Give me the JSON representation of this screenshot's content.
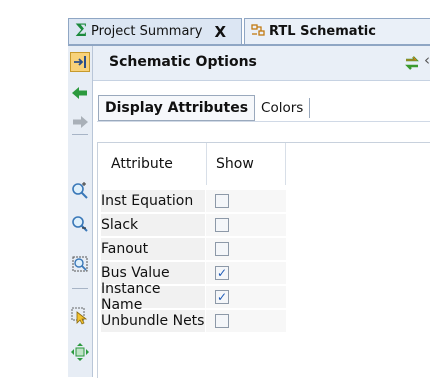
{
  "tabs": [
    {
      "label": "Project Summary",
      "icon": "sigma-icon",
      "close": "X"
    },
    {
      "label": "RTL Schematic",
      "icon": "schematic-icon"
    }
  ],
  "panel": {
    "title": "Schematic Options"
  },
  "subtabs": [
    {
      "label": "Display Attributes",
      "active": true
    },
    {
      "label": "Colors",
      "active": false
    }
  ],
  "table": {
    "headers": [
      "Attribute",
      "Show"
    ],
    "rows": [
      {
        "attribute": "Inst Equation",
        "show": false
      },
      {
        "attribute": "Slack",
        "show": false
      },
      {
        "attribute": "Fanout",
        "show": false
      },
      {
        "attribute": "Bus Value",
        "show": true
      },
      {
        "attribute": "Instance Name",
        "show": true
      },
      {
        "attribute": "Unbundle Nets",
        "show": false
      }
    ]
  },
  "toolbar": {
    "icons": [
      "collapse-panel-icon",
      "back-arrow-icon",
      "forward-arrow-icon",
      "zoom-in-icon",
      "zoom-out-icon",
      "zoom-fit-icon",
      "select-icon",
      "expand-icon"
    ]
  },
  "colors": {
    "accent": "#1c8a3c",
    "tab_border": "#8fa6c4",
    "check": "#1f5bb8"
  }
}
